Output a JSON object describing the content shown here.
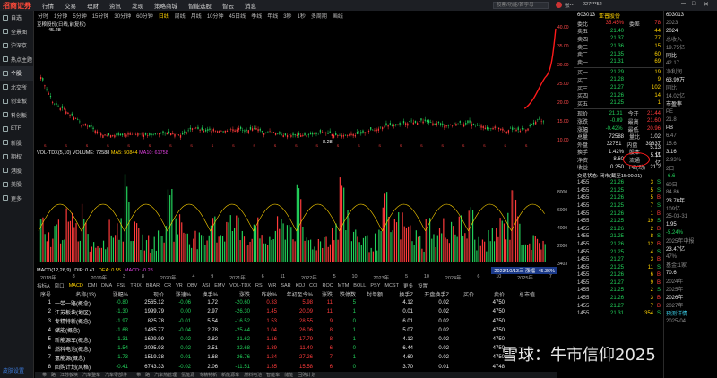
{
  "topbar": {
    "logo": "招商证券",
    "menus": [
      "行情",
      "交易",
      "理财",
      "资讯",
      "发现",
      "策略商城",
      "智能选股",
      "智云",
      "消息"
    ],
    "search_placeholder": "股票/功能/首字母",
    "user": "张**",
    "phone": "227***52"
  },
  "sidebar": {
    "items": [
      "自选",
      "全景图",
      "沪深京",
      "热点主题",
      "个股",
      "北交所",
      "创业板",
      "科创板",
      "ETF",
      "新股",
      "期权",
      "港股",
      "美股",
      "更多"
    ],
    "active": "个股",
    "footer": "皮肤设置"
  },
  "periods": {
    "items": [
      "分时",
      "1分钟",
      "5分钟",
      "15分钟",
      "30分钟",
      "60分钟",
      "日线",
      "周线",
      "月线",
      "10分钟",
      "45日线",
      "季线",
      "年线",
      "3秒",
      "1秒",
      "多周期",
      "画线"
    ],
    "active": "日线"
  },
  "kchart": {
    "title": "豆粮股份(日线,前复权)",
    "high_label": "45.28",
    "low_label": "8.28",
    "axis": [
      "40.00",
      "35.00",
      "30.00",
      "25.00",
      "20.00",
      "15.00",
      "10.00"
    ],
    "lb_axis": "10.00"
  },
  "volume": {
    "label": "VOL-TDX(5,10)",
    "vol": "VOLUME: 72588",
    "ma5": "MA5: 50844",
    "ma10": "MA10: 61758",
    "axis": [
      "8000",
      "6000",
      "4000",
      "2000",
      "3403"
    ]
  },
  "macd": {
    "label": "MACD(12,26,9)",
    "dif": "DIF: 0.41",
    "dea": "DEA: 0.55",
    "macd": "MACD: -0.28",
    "tip": "2023/10/13三 涨幅 -45.36%"
  },
  "dates": [
    "2018年",
    "8",
    "2019年",
    "3",
    "8",
    "2020年",
    "4",
    "9",
    "2021年",
    "6",
    "11",
    "2022年",
    "5",
    "10",
    "2023年",
    "5",
    "10",
    "2024年",
    "6",
    "10",
    "2025年",
    "7"
  ],
  "indicators": [
    "指标A",
    "窗口",
    "MACD",
    "DMI",
    "DMA",
    "FSL",
    "TRIX",
    "BRAR",
    "CR",
    "VR",
    "OBV",
    "ASI",
    "EMV",
    "VOL-TDX",
    "RSI",
    "WR",
    "SAR",
    "KDJ",
    "CCI",
    "ROC",
    "MTM",
    "BOLL",
    "PSY",
    "MCST",
    "更多",
    "设置"
  ],
  "table": {
    "headers": [
      "序号",
      "名称(13)",
      "涨幅%",
      "现价",
      "涨速%",
      "换手%",
      "涨跌",
      "昨收%",
      "年初至今%",
      "涨跌",
      "跌停数",
      "封单额",
      "换手Z",
      "开盘换手Z",
      "买价",
      "卖价",
      "总市值"
    ],
    "rows": [
      [
        "1",
        "一带一路(概念)",
        "-0.80",
        "2565.12",
        "-0.06",
        "1.72",
        "-20.60",
        "0.33",
        "5.98",
        "11",
        "5",
        "",
        "4.12",
        "0.02",
        "",
        "4750",
        ""
      ],
      [
        "2",
        "江苏板块(地区)",
        "-1.30",
        "1999.79",
        "0.00",
        "2.97",
        "-26.30",
        "1.45",
        "20.09",
        "11",
        "1",
        "",
        "0.01",
        "0.02",
        "",
        "4750",
        ""
      ],
      [
        "3",
        "专精特新(概念)",
        "-1.97",
        "825.78",
        "-0.01",
        "5.54",
        "-16.52",
        "1.53",
        "28.55",
        "9",
        "0",
        "",
        "6.01",
        "0.02",
        "",
        "4750",
        ""
      ],
      [
        "4",
        "储能(概念)",
        "-1.68",
        "1485.77",
        "-0.04",
        "2.78",
        "-25.44",
        "1.04",
        "26.06",
        "8",
        "1",
        "",
        "5.07",
        "0.02",
        "",
        "4750",
        ""
      ],
      [
        "5",
        "新能源车(概念)",
        "-1.31",
        "1629.99",
        "-0.02",
        "2.82",
        "-21.62",
        "1.16",
        "17.79",
        "8",
        "1",
        "",
        "4.12",
        "0.02",
        "",
        "4750",
        ""
      ],
      [
        "6",
        "燃料电池(概念)",
        "-1.54",
        "2095.93",
        "-0.02",
        "2.51",
        "-32.68",
        "1.39",
        "11.40",
        "6",
        "0",
        "",
        "6.44",
        "0.02",
        "",
        "4750",
        ""
      ],
      [
        "7",
        "氢能源(概念)",
        "-1.73",
        "1519.38",
        "-0.01",
        "1.68",
        "-26.76",
        "1.24",
        "27.26",
        "7",
        "1",
        "",
        "4.60",
        "0.02",
        "",
        "4750",
        ""
      ],
      [
        "8",
        "回购计划(风格)",
        "-0.41",
        "6743.33",
        "-0.02",
        "2.06",
        "-11.51",
        "1.35",
        "15.58",
        "6",
        "0",
        "",
        "3.70",
        "0.01",
        "",
        "4748",
        ""
      ]
    ]
  },
  "bottom_tabs": [
    "一带一路",
    "江苏板块",
    "汽车整车",
    "汽车零部件",
    "一带一路",
    "汽车热管理",
    "氢能源",
    "专精特新",
    "新能源车",
    "燃料电池",
    "智能车",
    "储能",
    "回购计划"
  ],
  "quote": {
    "code": "603013",
    "name": "亚普股份",
    "ratio": "委比",
    "ratio_v": "35.45%",
    "diff": "委差",
    "diff_v": "78",
    "asks": [
      [
        "卖五",
        "21.40",
        "44"
      ],
      [
        "卖四",
        "21.37",
        "77"
      ],
      [
        "卖三",
        "21.36",
        "15"
      ],
      [
        "卖二",
        "21.35",
        "60"
      ],
      [
        "卖一",
        "21.31",
        "69"
      ]
    ],
    "bids": [
      [
        "买一",
        "21.29",
        "19"
      ],
      [
        "买二",
        "21.28",
        "9"
      ],
      [
        "买三",
        "21.27",
        "102"
      ],
      [
        "买四",
        "21.26",
        "14"
      ],
      [
        "买五",
        "21.25",
        "1"
      ]
    ],
    "stats": [
      [
        "现价",
        "21.31",
        "今开",
        "21.44"
      ],
      [
        "涨跌",
        "-0.09",
        "最高",
        "21.60"
      ],
      [
        "涨幅",
        "-0.42%",
        "最低",
        "20.96"
      ],
      [
        "总量",
        "72588",
        "量比",
        "1.02"
      ],
      [
        "外盘",
        "32751",
        "内盘",
        "39837"
      ],
      [
        "换手",
        "1.42%",
        "股本",
        "5.13亿"
      ],
      [
        "净资",
        "8.60",
        "流通",
        "5.11亿"
      ],
      [
        "收益",
        "0.250",
        "PE(动)",
        "21.2"
      ]
    ],
    "trade_head": "交易状态: 闭市(截至15:00:01)",
    "trades": [
      [
        "1455",
        "21.26",
        "3",
        "S"
      ],
      [
        "1455",
        "21.25",
        "5",
        "S"
      ],
      [
        "1455",
        "21.26",
        "5",
        "B"
      ],
      [
        "1455",
        "21.25",
        "7",
        "S"
      ],
      [
        "1455",
        "21.26",
        "1",
        "B"
      ],
      [
        "1455",
        "21.25",
        "19",
        "S"
      ],
      [
        "1455",
        "21.26",
        "2",
        "B"
      ],
      [
        "1455",
        "21.25",
        "8",
        "S"
      ],
      [
        "1455",
        "21.26",
        "12",
        "B"
      ],
      [
        "1455",
        "21.25",
        "4",
        "S"
      ],
      [
        "1455",
        "21.27",
        "3",
        "B"
      ],
      [
        "1455",
        "21.25",
        "11",
        "S"
      ],
      [
        "1455",
        "21.26",
        "6",
        "B"
      ],
      [
        "1455",
        "21.27",
        "9",
        "B"
      ],
      [
        "1455",
        "21.25",
        "2",
        "S"
      ],
      [
        "1455",
        "21.26",
        "3",
        "B"
      ],
      [
        "1455",
        "21.27",
        "7",
        "B"
      ],
      [
        "1455",
        "21.31",
        "354",
        "S"
      ]
    ]
  },
  "far": {
    "code": "603013",
    "rows": [
      "2023",
      "2024",
      "总收入",
      "19.75亿",
      "同比",
      "42.17",
      "净利润",
      "63.99万",
      "同比",
      "14.02亿",
      "市盈率",
      "PE",
      "21.8",
      "PB",
      "6.47",
      "15.6",
      "3.16",
      "2.93%",
      "2日",
      "-6.6",
      "60日",
      "84.86",
      "23.78年",
      "109亿",
      "25-03-31",
      "1.95",
      "-5.24%",
      "2025年中报",
      "23.47亿",
      "47%",
      "基金:1家",
      "70.6",
      "2024年",
      "2025年",
      "2026年",
      "2027年"
    ],
    "tags": [
      "预测详情"
    ],
    "bottom": "2025-04"
  },
  "watermark": "雪球：牛市信仰2025",
  "colors": {
    "up": "#ff3b3b",
    "down": "#22d05a",
    "bg": "#000000",
    "accent": "#ffd200"
  }
}
